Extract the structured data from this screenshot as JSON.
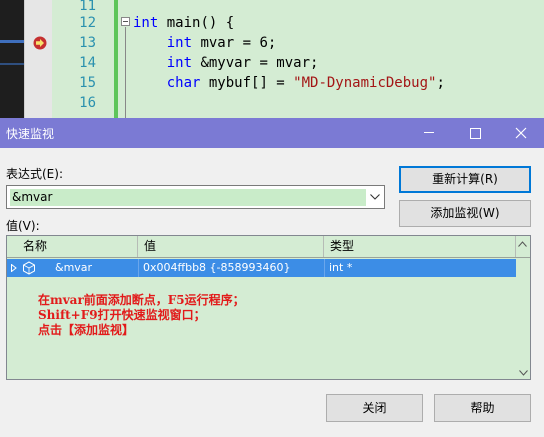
{
  "editor": {
    "lines": [
      {
        "no": "11",
        "code": []
      },
      {
        "no": "12",
        "code": [
          [
            "kw",
            "int"
          ],
          [
            "",
            " main() {"
          ]
        ]
      },
      {
        "no": "13",
        "code": [
          [
            "",
            "    "
          ],
          [
            "kw",
            "int"
          ],
          [
            "",
            " mvar = 6;"
          ]
        ]
      },
      {
        "no": "14",
        "code": [
          [
            "",
            "    "
          ],
          [
            "kw",
            "int"
          ],
          [
            "",
            " &myvar = mvar;"
          ]
        ]
      },
      {
        "no": "15",
        "code": [
          [
            "",
            "    "
          ],
          [
            "kw",
            "char"
          ],
          [
            "",
            " mybuf[] = "
          ],
          [
            "str",
            "\"MD-DynamicDebug\""
          ],
          [
            "",
            ";"
          ]
        ]
      },
      {
        "no": "16",
        "code": []
      }
    ],
    "current_line_indicator": "arrow-icon",
    "colors": {
      "background": "#d4ecd3",
      "keyword": "#0000ff",
      "string": "#a31515",
      "line_number": "#2b91af"
    }
  },
  "dialog": {
    "title": "快速监视",
    "expression_label": "表达式(E):",
    "expression_value": "&mvar",
    "value_label": "值(V):",
    "recalc_button": "重新计算(R)",
    "add_watch_button": "添加监视(W)",
    "close_button": "关闭",
    "help_button": "帮助",
    "columns": {
      "name": "名称",
      "value": "值",
      "type": "类型"
    },
    "rows": [
      {
        "name": "&mvar",
        "value": "0x004ffbb8 {-858993460}",
        "type": "int *"
      }
    ],
    "annotation": "在mvar前面添加断点，F5运行程序；\nShift+F9打开快速监视窗口；\n点击【添加监视】",
    "colors": {
      "titlebar": "#7b7ad4",
      "selected_row": "#3c8de6",
      "annotation": "#e21a1a",
      "highlight": "#c9ecc9"
    }
  }
}
